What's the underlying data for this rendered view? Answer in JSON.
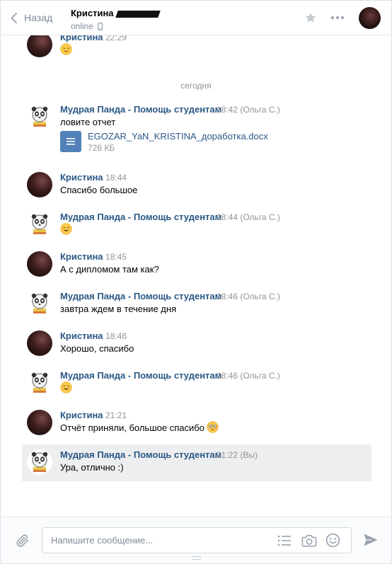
{
  "header": {
    "back_label": "Назад",
    "contact_name": "Кристина",
    "status": "online"
  },
  "colors": {
    "link": "#2a5885",
    "muted": "#939393",
    "accent": "#5181b8",
    "selected_bg": "#edeef0"
  },
  "icons": [
    "chevron-left-icon",
    "phone-icon",
    "star-icon",
    "more-icon",
    "paperclip-icon",
    "list-icon",
    "camera-icon",
    "smile-icon",
    "send-icon",
    "document-icon"
  ],
  "top_partial": {
    "name": "Кристина",
    "time": "22:29",
    "emoji": "relieved-face"
  },
  "date_separator": "сегодня",
  "messages": [
    {
      "name": "Мудрая Панда - Помощь студентам",
      "time": "18:42 (Ольга С.)",
      "text": "ловите отчет",
      "avatar": "panda"
    },
    {
      "name": "Кристина",
      "time": "18:44",
      "text": "Спасибо большое",
      "avatar": "kristina"
    },
    {
      "name": "Мудрая Панда - Помощь студентам",
      "time": "18:44 (Ольга С.)",
      "text": "",
      "emoji": "smiling-face",
      "avatar": "panda"
    },
    {
      "name": "Кристина",
      "time": "18:45",
      "text": "А с дипломом там как?",
      "avatar": "kristina"
    },
    {
      "name": "Мудрая Панда - Помощь студентам",
      "time": "18:46 (Ольга С.)",
      "text": "завтра ждем в течение дня",
      "avatar": "panda"
    },
    {
      "name": "Кристина",
      "time": "18:46",
      "text": "Хорошо, спасибо",
      "avatar": "kristina"
    },
    {
      "name": "Мудрая Панда - Помощь студентам",
      "time": "18:46 (Ольга С.)",
      "text": "",
      "emoji": "smiling-face",
      "avatar": "panda"
    },
    {
      "name": "Кристина",
      "time": "21:21",
      "text": "Отчёт приняли, большое спасибо",
      "emoji": "flushed-face",
      "avatar": "kristina"
    },
    {
      "name": "Мудрая Панда - Помощь студентам",
      "time": "21:22 (Вы)",
      "text": "Ура, отлично :)",
      "avatar": "panda",
      "selected": true
    }
  ],
  "attachment": {
    "filename": "EGOZAR_YaN_KRISTINA_доработка.docx",
    "size": "726 КБ"
  },
  "composer": {
    "placeholder": "Напишите сообщение..."
  }
}
